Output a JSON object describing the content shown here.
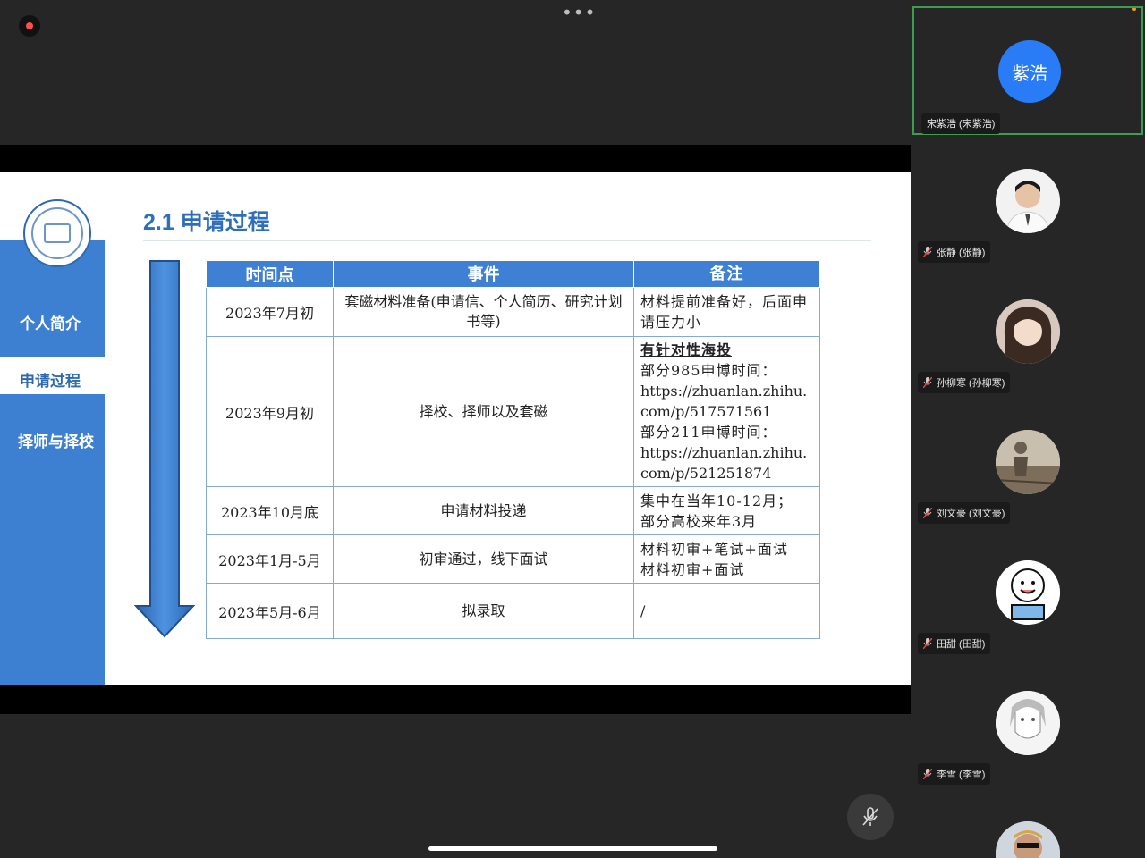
{
  "meeting": {
    "more_icon": "more-horizontal-icon",
    "mute_icon": "mic-off-icon"
  },
  "slide": {
    "title": "2.1 申请过程",
    "nav": [
      "个人简介",
      "申请过程",
      "择师与择校"
    ],
    "table": {
      "headers": [
        "时间点",
        "事件",
        "备注"
      ],
      "rows": [
        {
          "time": "2023年7月初",
          "event": "套磁材料准备(申请信、个人简历、研究计划书等)",
          "note": [
            "材料提前准备好，后面申请压力小"
          ]
        },
        {
          "time": "2023年9月初",
          "event": "择校、择师以及套磁",
          "note_heading": "有针对性海投",
          "note": [
            "部分985申博时间：",
            "https://zhuanlan.zhihu.com/p/517571561",
            "部分211申博时间：",
            "https://zhuanlan.zhihu.com/p/521251874"
          ]
        },
        {
          "time": "2023年10月底",
          "event": "申请材料投递",
          "note": [
            "集中在当年10-12月；",
            "部分高校来年3月"
          ]
        },
        {
          "time": "2023年1月-5月",
          "event": "初审通过，线下面试",
          "note": [
            "材料初审+笔试+面试",
            "材料初审+面试"
          ]
        },
        {
          "time": "2023年5月-6月",
          "event": "拟录取",
          "note": [
            "/"
          ]
        }
      ]
    }
  },
  "participants": {
    "active_speaker": {
      "avatar_text": "紫浩",
      "name": "宋紫浩 (宋紫浩)",
      "avatar_color": "#2a7bf6"
    },
    "list": [
      {
        "name": "张静 (张静)"
      },
      {
        "name": "孙柳寒 (孙柳寒)"
      },
      {
        "name": "刘文豪 (刘文豪)"
      },
      {
        "name": "田甜 (田甜)"
      },
      {
        "name": "李雪 (李雪)"
      }
    ]
  },
  "colors": {
    "accent": "#3d80d4",
    "speaker_border": "#3c9d4f"
  }
}
